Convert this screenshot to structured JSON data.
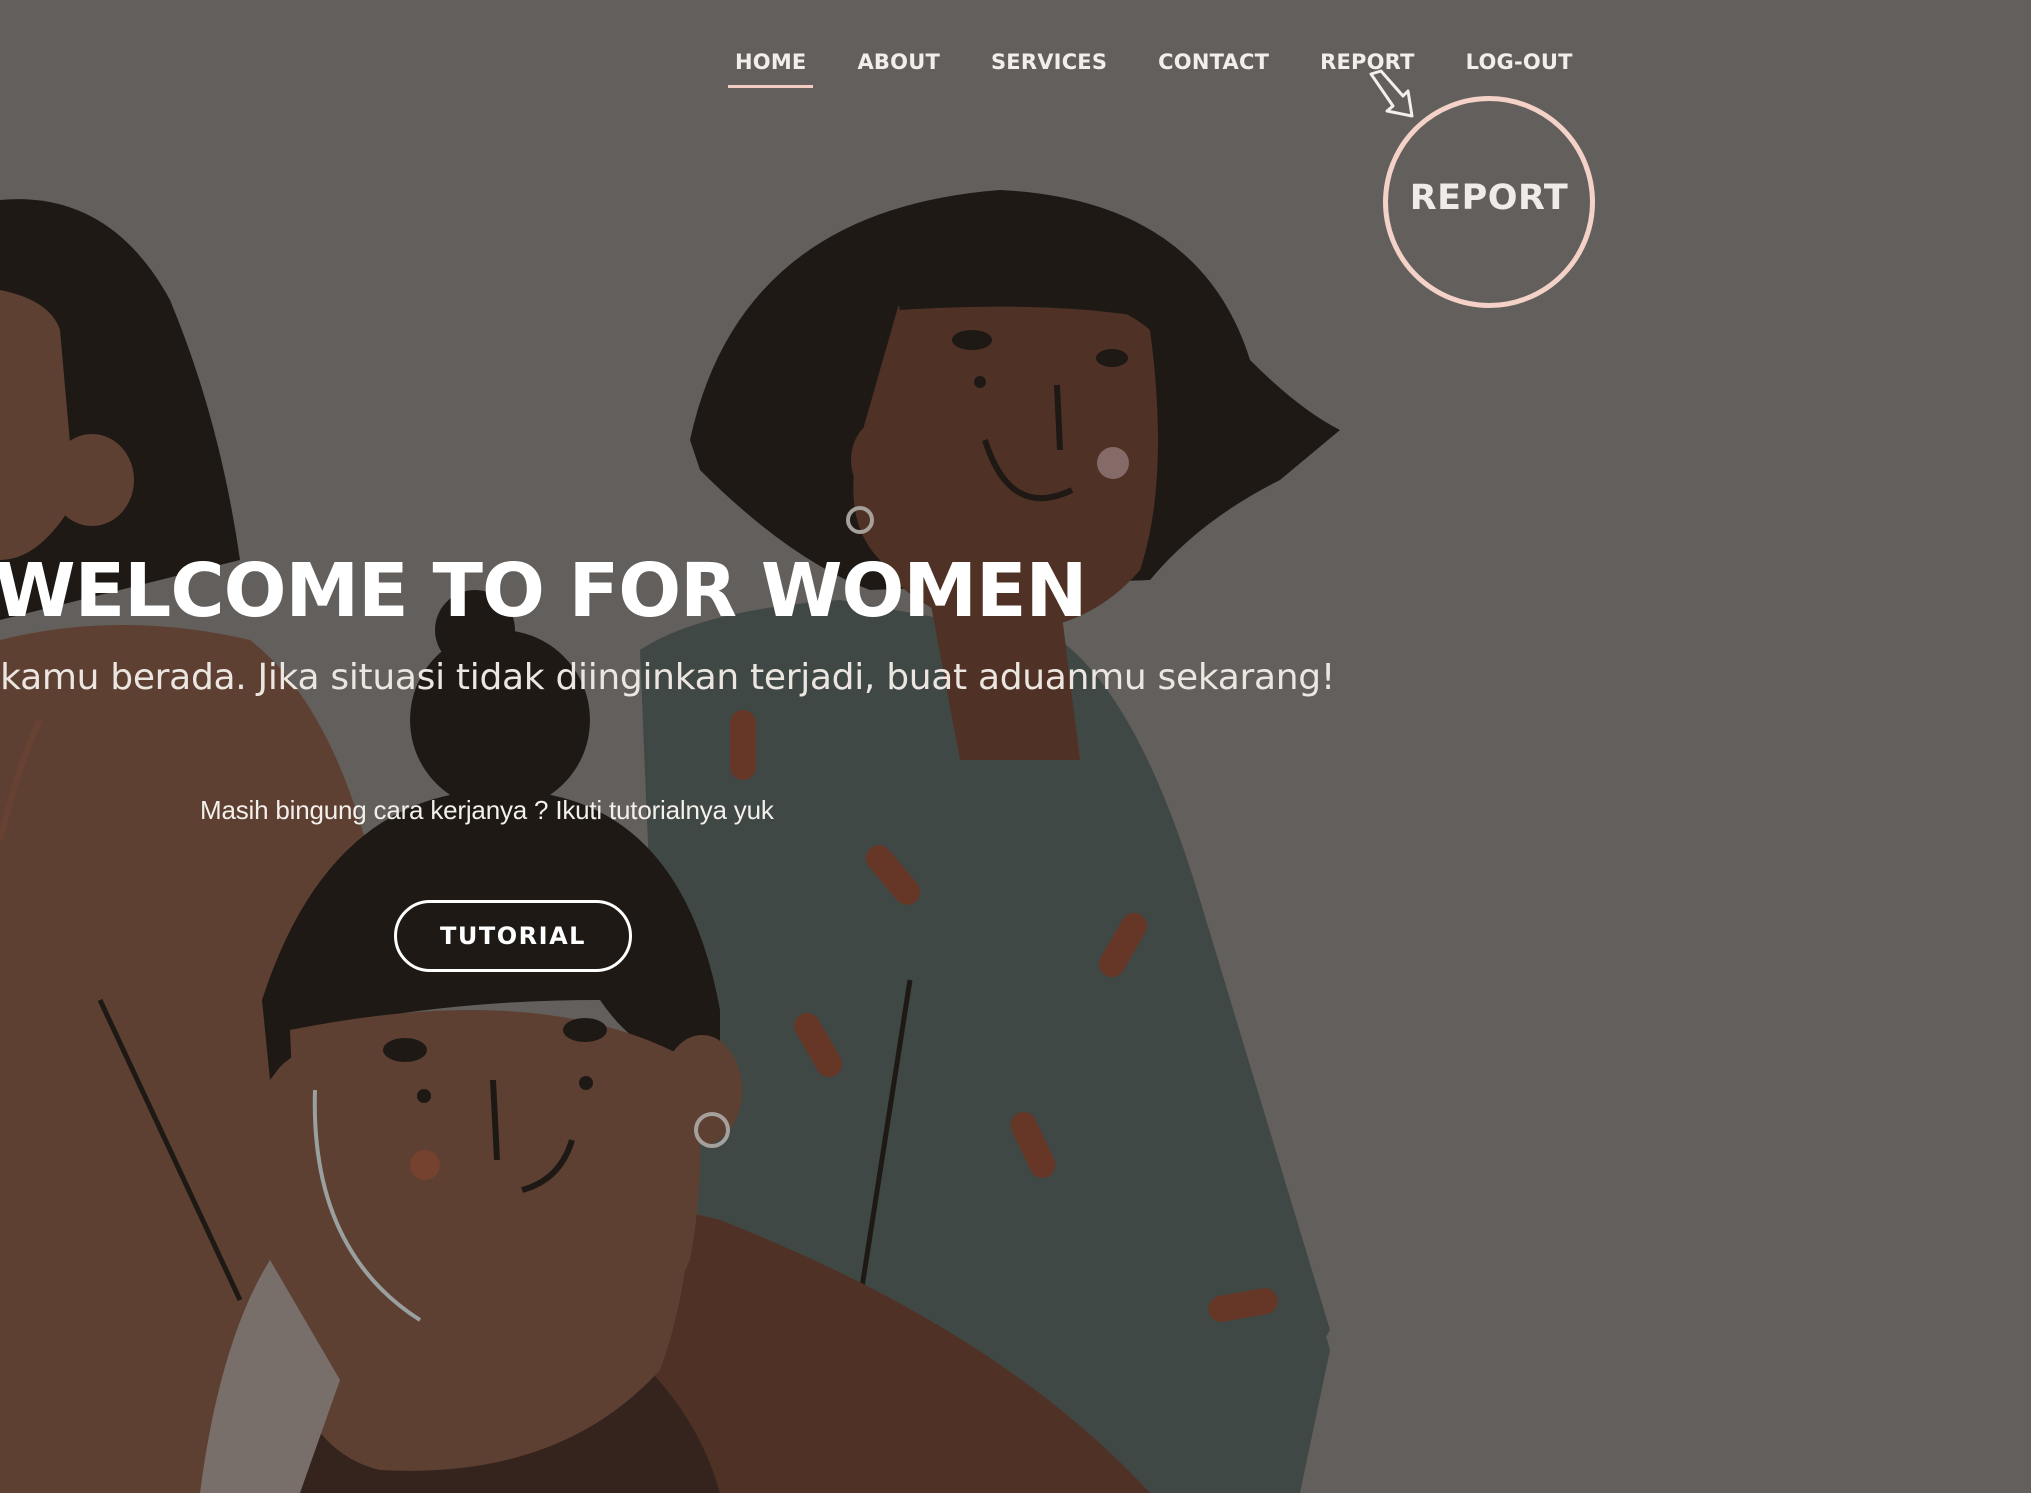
{
  "nav": {
    "items": [
      {
        "label": "HOME",
        "active": true
      },
      {
        "label": "ABOUT",
        "active": false
      },
      {
        "label": "SERVICES",
        "active": false
      },
      {
        "label": "CONTACT",
        "active": false
      },
      {
        "label": "REPORT",
        "active": false
      },
      {
        "label": "LOG-OUT",
        "active": false
      }
    ]
  },
  "callout": {
    "label": "REPORT",
    "icon": "arrow-pointer-icon"
  },
  "hero": {
    "title": "WELCOME TO FOR WOMEN",
    "subtitle": "un kamu berada. Jika situasi tidak diinginkan terjadi, buat aduanmu sekarang!",
    "hint": "Masih bingung cara kerjanya ? Ikuti tutorialnya yuk",
    "button_label": "TUTORIAL"
  },
  "colors": {
    "background": "#65615f",
    "accent": "#f3cdc2",
    "text": "#ffffff"
  }
}
